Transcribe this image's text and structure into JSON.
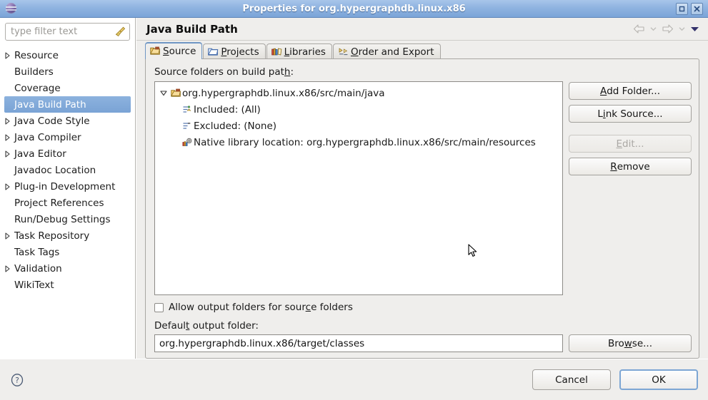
{
  "window": {
    "title": "Properties for org.hypergraphdb.linux.x86",
    "icon": "eclipse-globe-icon",
    "buttons": [
      {
        "name": "maximize-button",
        "glyph": "maximize"
      },
      {
        "name": "close-button",
        "glyph": "close"
      }
    ]
  },
  "sidebar": {
    "filter": {
      "placeholder": "type filter text",
      "value": "",
      "clear_icon": "broom-icon"
    },
    "items": [
      {
        "label": "Resource",
        "expandable": true,
        "selected": false
      },
      {
        "label": "Builders",
        "expandable": false,
        "selected": false
      },
      {
        "label": "Coverage",
        "expandable": false,
        "selected": false
      },
      {
        "label": "Java Build Path",
        "expandable": false,
        "selected": true
      },
      {
        "label": "Java Code Style",
        "expandable": true,
        "selected": false
      },
      {
        "label": "Java Compiler",
        "expandable": true,
        "selected": false
      },
      {
        "label": "Java Editor",
        "expandable": true,
        "selected": false
      },
      {
        "label": "Javadoc Location",
        "expandable": false,
        "selected": false
      },
      {
        "label": "Plug-in Development",
        "expandable": true,
        "selected": false
      },
      {
        "label": "Project References",
        "expandable": false,
        "selected": false
      },
      {
        "label": "Run/Debug Settings",
        "expandable": false,
        "selected": false
      },
      {
        "label": "Task Repository",
        "expandable": true,
        "selected": false
      },
      {
        "label": "Task Tags",
        "expandable": false,
        "selected": false
      },
      {
        "label": "Validation",
        "expandable": true,
        "selected": false
      },
      {
        "label": "WikiText",
        "expandable": false,
        "selected": false
      }
    ]
  },
  "page": {
    "title": "Java Build Path",
    "nav": {
      "back_icon": "back-arrow-icon",
      "back_chevron_icon": "chevron-down-icon",
      "forward_icon": "forward-arrow-icon",
      "forward_chevron_icon": "chevron-down-icon",
      "menu_icon": "view-menu-icon"
    }
  },
  "tabs": [
    {
      "label": "Source",
      "mnemonic": "S",
      "icon": "source-folder-icon",
      "active": true
    },
    {
      "label": "Projects",
      "mnemonic": "P",
      "icon": "project-folder-icon",
      "active": false
    },
    {
      "label": "Libraries",
      "mnemonic": "L",
      "icon": "libraries-icon",
      "active": false
    },
    {
      "label": "Order and Export",
      "mnemonic": "O",
      "icon": "order-export-icon",
      "active": false
    }
  ],
  "source_tab": {
    "tree_label": "Source folders on build path:",
    "tree_label_mnemonic": "h",
    "tree": [
      {
        "label": "org.hypergraphdb.linux.x86/src/main/java",
        "icon": "source-folder-icon",
        "expanded": true,
        "level": 0,
        "children": [
          {
            "label": "Included: (All)",
            "icon": "included-filter-icon",
            "level": 1
          },
          {
            "label": "Excluded: (None)",
            "icon": "excluded-filter-icon",
            "level": 1
          },
          {
            "label": "Native library location: org.hypergraphdb.linux.x86/src/main/resources",
            "icon": "native-library-icon",
            "level": 1
          }
        ]
      }
    ],
    "buttons": [
      {
        "label": "Add Folder...",
        "mnemonic": "A",
        "name": "add-folder-button",
        "enabled": true
      },
      {
        "label": "Link Source...",
        "mnemonic": "i",
        "name": "link-source-button",
        "enabled": true
      },
      {
        "label": "Edit...",
        "mnemonic": "E",
        "name": "edit-button",
        "enabled": false
      },
      {
        "label": "Remove",
        "mnemonic": "R",
        "name": "remove-button",
        "enabled": true
      }
    ],
    "allow_output": {
      "label": "Allow output folders for source folders",
      "mnemonic": "c",
      "checked": false
    },
    "default_output": {
      "label": "Default output folder:",
      "mnemonic": "t",
      "value": "org.hypergraphdb.linux.x86/target/classes",
      "browse_label": "Browse...",
      "browse_mnemonic": "w"
    }
  },
  "footer": {
    "help_icon": "help-question-icon",
    "cancel_label": "Cancel",
    "ok_label": "OK"
  },
  "colors": {
    "titlebar_start": "#a8c6ea",
    "titlebar_end": "#7ba4d8",
    "selection": "#7aa3d5",
    "dialog_bg": "#efeeec",
    "accent_border": "#6f96c4"
  }
}
